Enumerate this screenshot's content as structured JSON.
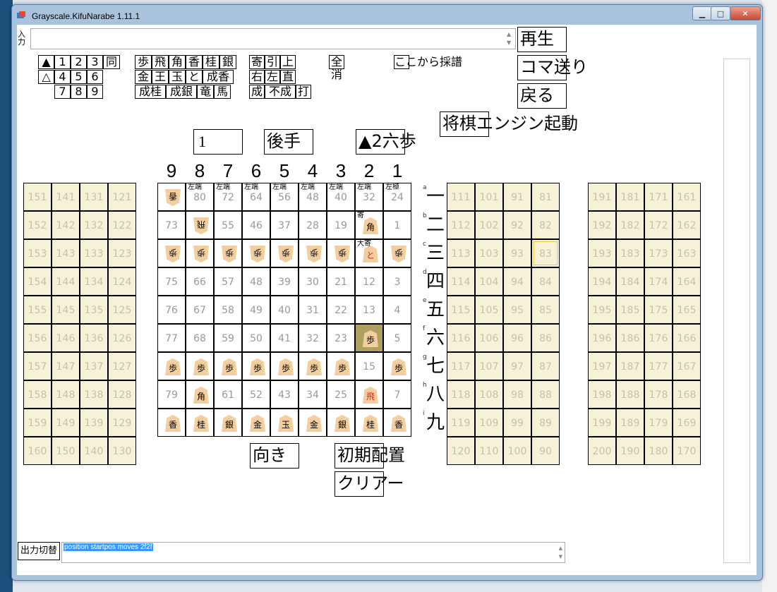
{
  "window": {
    "title": "Grayscale.KifuNarabe 1.11.1"
  },
  "input": {
    "label": "入力",
    "value": ""
  },
  "kifu_buttons": {
    "row1": [
      "▲",
      "1",
      "2",
      "3",
      "同"
    ],
    "row2": [
      "△",
      "4",
      "5",
      "6"
    ],
    "row3": [
      "7",
      "8",
      "9"
    ],
    "pieces_row1": [
      "歩",
      "飛",
      "角",
      "香",
      "桂",
      "銀"
    ],
    "pieces_row2": [
      "金",
      "王",
      "玉",
      "と",
      "成香"
    ],
    "pieces_row3": [
      "成桂",
      "成銀",
      "竜",
      "馬"
    ],
    "mods_row1": [
      "寄",
      "引",
      "上"
    ],
    "mods_row2": [
      "右",
      "左",
      "直"
    ],
    "mods_row3": [
      "成",
      "不成",
      "打"
    ],
    "clear_all": "全消",
    "from_here": "ここから採譜"
  },
  "controls": {
    "play": "再生",
    "step": "コマ送り",
    "back": "戻る",
    "engine": "将棋エンジン起動",
    "turn_count": "1",
    "side": "後手",
    "last_move": "▲2六歩",
    "orientation": "向き",
    "initial": "初期配置",
    "clear": "クリアー",
    "output_toggle": "出力切替"
  },
  "board": {
    "files": [
      "9",
      "8",
      "7",
      "6",
      "5",
      "4",
      "3",
      "2",
      "1"
    ],
    "ranks": [
      "一",
      "二",
      "三",
      "四",
      "五",
      "六",
      "七",
      "八",
      "九"
    ],
    "rank_letters": [
      "a",
      "b",
      "c",
      "d",
      "e",
      "f",
      "g",
      "h",
      "i"
    ],
    "cells": [
      [
        "香",
        "80",
        "72",
        "64",
        "56",
        "48",
        "40",
        "32",
        "24"
      ],
      [
        "73",
        "飛",
        "55",
        "46",
        "37",
        "28",
        "19",
        "角",
        "1"
      ],
      [
        "歩",
        "歩",
        "歩",
        "歩",
        "歩",
        "歩",
        "歩",
        "と",
        "歩"
      ],
      [
        "75",
        "66",
        "57",
        "48",
        "39",
        "30",
        "21",
        "12",
        "3"
      ],
      [
        "76",
        "67",
        "58",
        "49",
        "40",
        "31",
        "22",
        "13",
        "4"
      ],
      [
        "77",
        "68",
        "59",
        "50",
        "41",
        "32",
        "23",
        "歩",
        "5"
      ],
      [
        "歩",
        "歩",
        "歩",
        "歩",
        "歩",
        "歩",
        "歩",
        "15",
        "歩"
      ],
      [
        "79",
        "角",
        "61",
        "52",
        "43",
        "34",
        "25",
        "飛",
        "7"
      ],
      [
        "香",
        "桂",
        "銀",
        "金",
        "玉",
        "金",
        "銀",
        "桂",
        "香"
      ]
    ],
    "tags_top": [
      "",
      "左端",
      "左端",
      "左端",
      "左端",
      "左端",
      "左端",
      "左端",
      "左極"
    ],
    "tags_row1": [
      "",
      "",
      "",
      "",
      "",
      "",
      "",
      "寄",
      ""
    ],
    "tags_row2": [
      "",
      "",
      "",
      "",
      "",
      "",
      "",
      "大寄",
      ""
    ]
  },
  "hands": {
    "left": [
      [
        "151",
        "141",
        "131",
        "121"
      ],
      [
        "152",
        "142",
        "132",
        "122"
      ],
      [
        "153",
        "143",
        "133",
        "123"
      ],
      [
        "154",
        "144",
        "134",
        "124"
      ],
      [
        "155",
        "145",
        "135",
        "125"
      ],
      [
        "156",
        "146",
        "136",
        "126"
      ],
      [
        "157",
        "147",
        "137",
        "127"
      ],
      [
        "158",
        "148",
        "138",
        "128"
      ],
      [
        "159",
        "149",
        "139",
        "129"
      ],
      [
        "160",
        "150",
        "140",
        "130"
      ]
    ],
    "mid": [
      [
        "111",
        "101",
        "91",
        "81"
      ],
      [
        "112",
        "102",
        "92",
        "82"
      ],
      [
        "113",
        "103",
        "93",
        "83"
      ],
      [
        "114",
        "104",
        "94",
        "84"
      ],
      [
        "115",
        "105",
        "95",
        "85"
      ],
      [
        "116",
        "106",
        "96",
        "86"
      ],
      [
        "117",
        "107",
        "97",
        "87"
      ],
      [
        "118",
        "108",
        "98",
        "88"
      ],
      [
        "119",
        "109",
        "99",
        "89"
      ],
      [
        "120",
        "110",
        "100",
        "90"
      ]
    ],
    "right": [
      [
        "191",
        "181",
        "171",
        "161"
      ],
      [
        "192",
        "182",
        "172",
        "162"
      ],
      [
        "193",
        "183",
        "173",
        "163"
      ],
      [
        "194",
        "184",
        "174",
        "164"
      ],
      [
        "195",
        "185",
        "175",
        "165"
      ],
      [
        "196",
        "186",
        "176",
        "166"
      ],
      [
        "197",
        "187",
        "177",
        "167"
      ],
      [
        "198",
        "188",
        "178",
        "168"
      ],
      [
        "199",
        "189",
        "179",
        "169"
      ],
      [
        "200",
        "190",
        "180",
        "170"
      ]
    ]
  },
  "output": {
    "value": "position startpos moves 2f2f"
  },
  "colors": {
    "accent": "#4da3ff",
    "hand_bg": "#f6f2d8",
    "piece": "#f3cfa0"
  }
}
